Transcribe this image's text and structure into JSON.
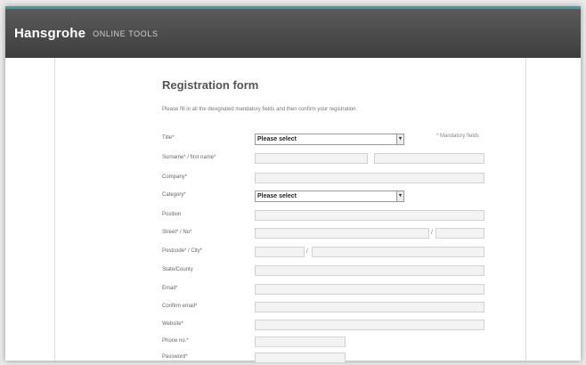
{
  "header": {
    "brand": "Hansgrohe",
    "subtitle": "ONLINE TOOLS"
  },
  "form": {
    "title": "Registration form",
    "intro": "Please fill in all the designated mandatory fields and then confirm your registration.",
    "mandatory_note": "* Mandatory fields",
    "rows": {
      "title": {
        "label": "Title*",
        "select_value": "Please select"
      },
      "name": {
        "label": "Surname* / first name*"
      },
      "company": {
        "label": "Company*"
      },
      "category": {
        "label": "Category*",
        "select_value": "Please select"
      },
      "position": {
        "label": "Position"
      },
      "street": {
        "label": "Street* / No*"
      },
      "postcode": {
        "label": "Postcode* / City*"
      },
      "state": {
        "label": "State/County"
      },
      "email": {
        "label": "Email*"
      },
      "confirm_email": {
        "label": "Confirm email*"
      },
      "website": {
        "label": "Website*"
      },
      "phone": {
        "label": "Phone no.*"
      },
      "password": {
        "label": "Password*"
      }
    },
    "dropdown_arrow": "▾"
  }
}
